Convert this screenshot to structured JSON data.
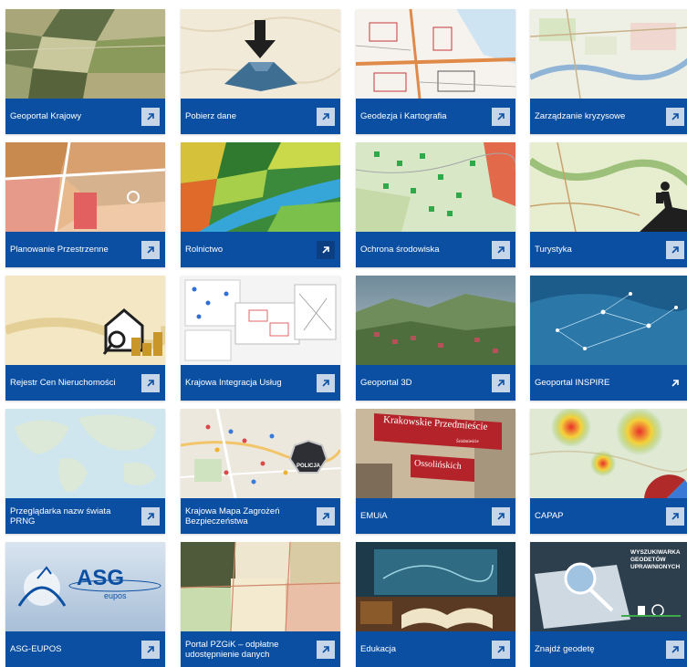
{
  "tiles": [
    {
      "label": "Geoportal Krajowy",
      "thumb": "aerial-orthophoto"
    },
    {
      "label": "Pobierz dane",
      "thumb": "download-map"
    },
    {
      "label": "Geodezja i Kartografia",
      "thumb": "cadastral-map"
    },
    {
      "label": "Zarządzanie kryzysowe",
      "thumb": "crisis-map"
    },
    {
      "label": "Planowanie Przestrzenne",
      "thumb": "zoning-map"
    },
    {
      "label": "Rolnictwo",
      "thumb": "agriculture-map"
    },
    {
      "label": "Ochrona środowiska",
      "thumb": "environment-map"
    },
    {
      "label": "Turystyka",
      "thumb": "tourism-map"
    },
    {
      "label": "Rejestr Cen Nieruchomości",
      "thumb": "property-prices"
    },
    {
      "label": "Krajowa Integracja Usług",
      "thumb": "service-integration"
    },
    {
      "label": "Geoportal 3D",
      "thumb": "terrain-3d"
    },
    {
      "label": "Geoportal INSPIRE",
      "thumb": "inspire-network"
    },
    {
      "label": "Przeglądarka nazw świata PRNG",
      "thumb": "world-map"
    },
    {
      "label": "Krajowa Mapa Zagrożeń Bezpieczeństwa",
      "thumb": "police-map"
    },
    {
      "label": "EMUiA",
      "thumb": "street-sign"
    },
    {
      "label": "CAPAP",
      "thumb": "heatmap"
    },
    {
      "label": "ASG-EUPOS",
      "thumb": "asg-eupos-logo"
    },
    {
      "label": "Portal PZGiK – odpłatne udostępnienie danych",
      "thumb": "paid-data"
    },
    {
      "label": "Edukacja",
      "thumb": "education-books"
    },
    {
      "label": "Znajdź geodetę",
      "thumb": "surveyor-search"
    }
  ],
  "thumb_text": {
    "police_badge": "POLICJA",
    "street_sign_1": "Krakowskie Przedmieście",
    "street_sign_1_sub": "Śródmieście",
    "street_sign_2": "Ossolińskich",
    "asg_logo": "ASG",
    "asg_logo_sub": "eupos",
    "surveyor_line1": "WYSZUKIWARKA",
    "surveyor_line2": "GEODETÓW",
    "surveyor_line3": "UPRAWNIONYCH"
  },
  "colors": {
    "tile_bar": "#0b4fa3",
    "arrow_box": "#c7d5e8",
    "label_text": "#ffffff"
  }
}
